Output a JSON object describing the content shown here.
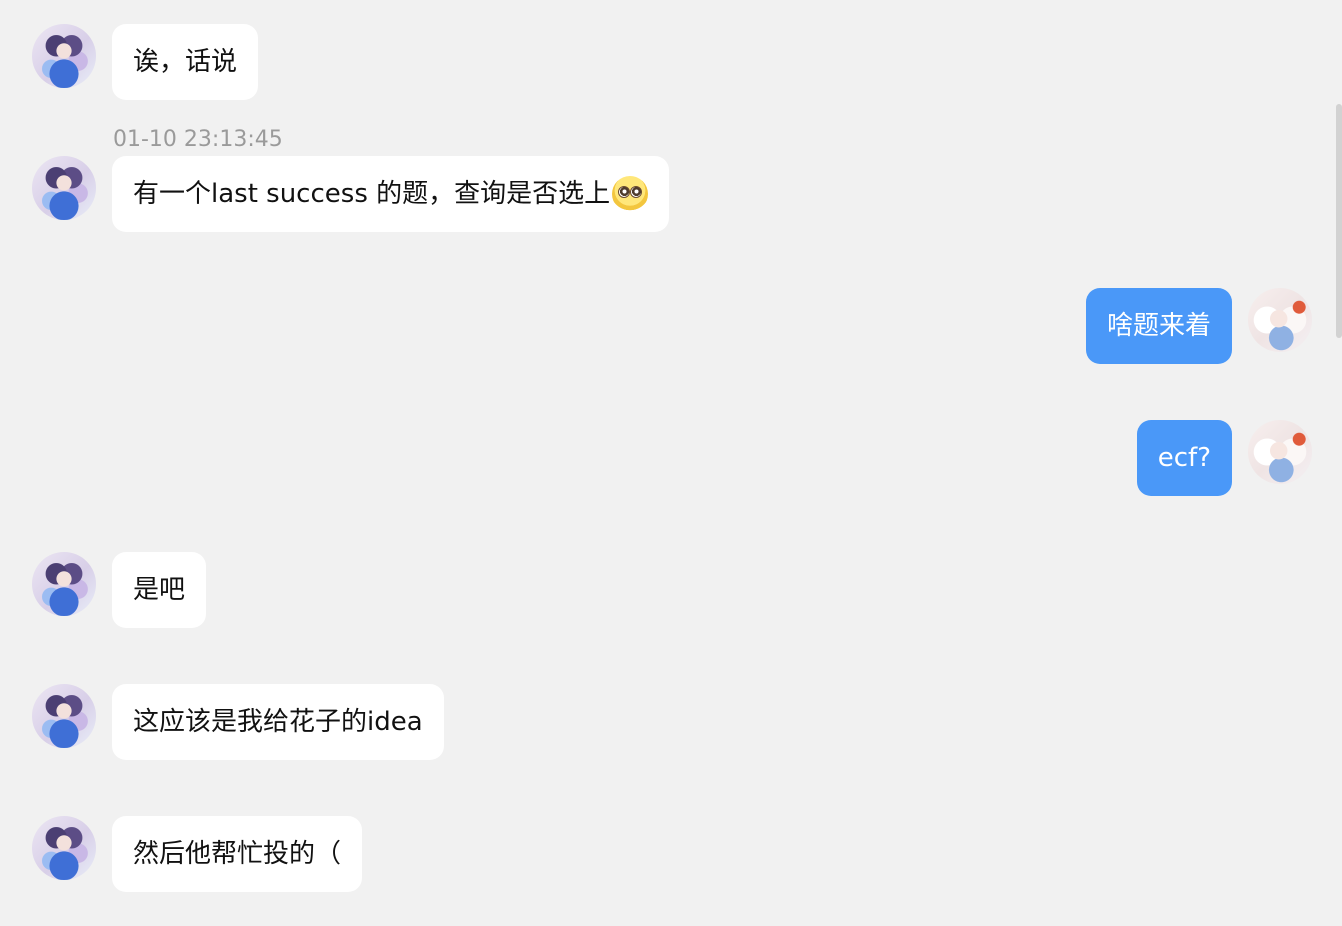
{
  "timestamp": "01-10 23:13:45",
  "messages": [
    {
      "side": "left",
      "text": "诶，话说"
    },
    {
      "side": "left",
      "text": "有一个last success 的题，查询是否选上",
      "emoji": "pleading-face-icon"
    },
    {
      "side": "right",
      "text": "啥题来着"
    },
    {
      "side": "right",
      "text": "ecf?"
    },
    {
      "side": "left",
      "text": "是吧"
    },
    {
      "side": "left",
      "text": "这应该是我给花子的idea"
    },
    {
      "side": "left",
      "text": "然后他帮忙投的（"
    }
  ],
  "colors": {
    "background": "#f1f1f1",
    "incoming_bubble": "#ffffff",
    "outgoing_bubble": "#4a98f8",
    "timestamp": "#9a9a9a"
  }
}
